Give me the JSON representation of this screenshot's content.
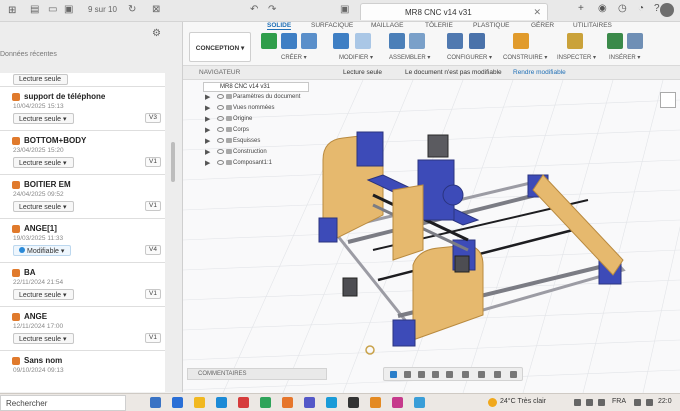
{
  "topbar": {
    "counter": "9 sur 10",
    "doc_tab": "MR8 CNC v14 v31"
  },
  "left_panel": {
    "section_label": "Données récentes",
    "partial_status": "Lecture seule",
    "items": [
      {
        "name": "support de téléphone",
        "date": "10/04/2025 15:13",
        "status": "Lecture seule",
        "version": "V3"
      },
      {
        "name": "BOTTOM+BODY",
        "date": "23/04/2025 15:20",
        "status": "Lecture seule",
        "version": "V1"
      },
      {
        "name": "BOITIER EM",
        "date": "24/04/2025 09:52",
        "status": "Lecture seule",
        "version": "V1"
      },
      {
        "name": "ANGE[1]",
        "date": "19/03/2025 11:33",
        "status": "Modifiable",
        "version": "V4"
      },
      {
        "name": "BA",
        "date": "22/11/2024 21:54",
        "status": "Lecture seule",
        "version": "V1"
      },
      {
        "name": "ANGE",
        "date": "12/11/2024 17:00",
        "status": "Lecture seule",
        "version": "V1"
      },
      {
        "name": "Sans nom",
        "date": "09/10/2024 09:13",
        "status": "",
        "version": ""
      }
    ]
  },
  "ribbon": {
    "tabs": [
      "SOLIDE",
      "SURFACIQUE",
      "MAILLAGE",
      "TÔLERIE",
      "PLASTIQUE",
      "GÉRER",
      "UTILITAIRES"
    ],
    "design_button": "CONCEPTION ▾",
    "groups": [
      "CRÉER ▾",
      "MODIFIER ▾",
      "ASSEMBLER ▾",
      "CONFIGURER ▾",
      "CONSTRUIRE ▾",
      "INSPECTER ▾",
      "INSÉRER ▾"
    ]
  },
  "infobar": {
    "navigator": "NAVIGATEUR",
    "read_only": "Lecture seule",
    "message": "Le document n'est pas modifiable",
    "action": "Rendre modifiable"
  },
  "tree": {
    "root": "MR8 CNC v14 v31",
    "rows": [
      "Paramètres du document",
      "Vues nommées",
      "Origine",
      "Corps",
      "Esquisses",
      "Construction",
      "Composant1:1"
    ]
  },
  "canvas": {
    "comments": "COMMENTAIRES"
  },
  "taskbar": {
    "search": "Rechercher",
    "weather": "24°C  Très clair",
    "lang": "FRA",
    "clock": "22:0"
  }
}
